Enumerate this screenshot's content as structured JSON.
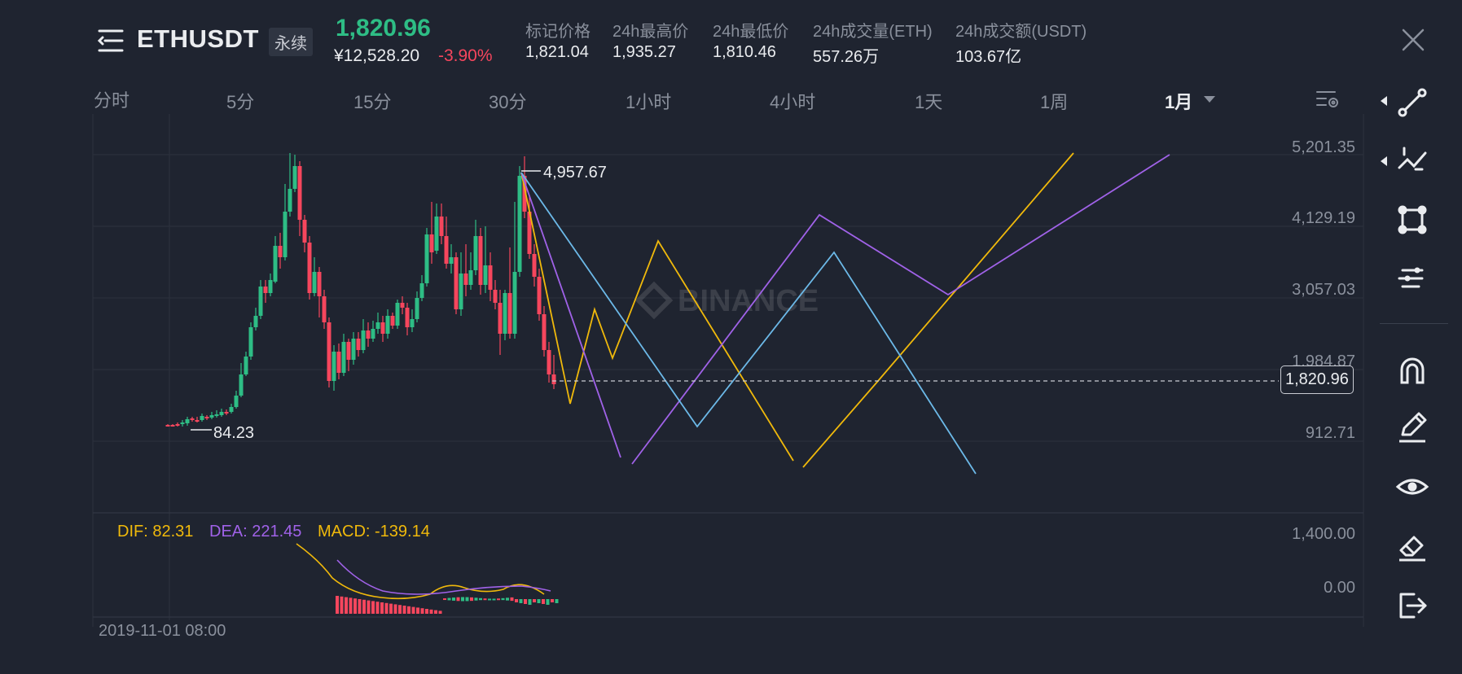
{
  "header": {
    "symbol": "ETHUSDT",
    "contract_badge": "永续",
    "last_price": "1,820.96",
    "cny_price": "¥12,528.20",
    "change_pct": "-3.90%",
    "stats": [
      {
        "label": "标记价格",
        "value": "1,821.04"
      },
      {
        "label": "24h最高价",
        "value": "1,935.27"
      },
      {
        "label": "24h最低价",
        "value": "1,810.46"
      },
      {
        "label": "24h成交量(ETH)",
        "value": "557.26万"
      },
      {
        "label": "24h成交额(USDT)",
        "value": "103.67亿"
      }
    ]
  },
  "tabs": [
    "分时",
    "5分",
    "15分",
    "30分",
    "1小时",
    "4小时",
    "1天",
    "1周",
    "1月"
  ],
  "active_tab": "1月",
  "chart": {
    "watermark": "BINANCE",
    "y_axis_labels": [
      "5,201.35",
      "4,129.19",
      "3,057.03",
      "1,984.87",
      "912.71"
    ],
    "current_price": "1,820.96",
    "high_marker": "4,957.67",
    "low_marker": "84.23",
    "macd": {
      "dif": "DIF: 82.31",
      "dea": "DEA: 221.45",
      "macd": "MACD: -139.14",
      "y_labels": [
        "1,400.00",
        "0.00"
      ]
    },
    "start_date": "2019-11-01 08:00"
  },
  "colors": {
    "up": "#2ebd85",
    "down": "#f6465d",
    "yellow": "#f0b90b",
    "purple": "#a062e8",
    "blue": "#6cb9e8",
    "background": "#1f2430"
  },
  "toolbar_icons": [
    "line-tool-icon",
    "fib-tool-icon",
    "shape-tool-icon",
    "indicator-settings-icon",
    "magnet-icon",
    "pencil-icon",
    "eye-icon",
    "eraser-icon",
    "exit-icon"
  ]
}
